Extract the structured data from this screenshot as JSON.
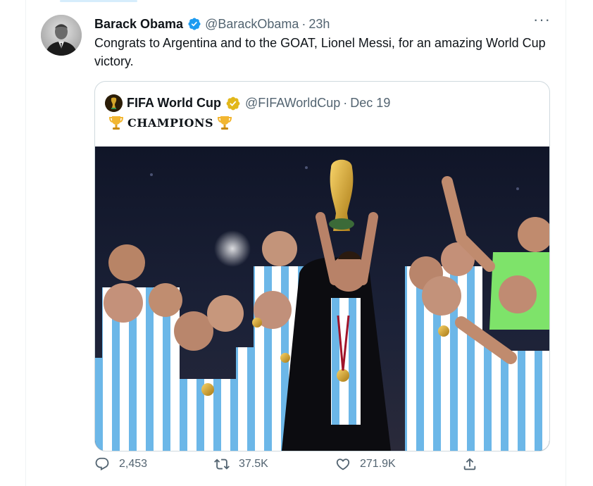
{
  "tweet": {
    "author_name": "Barack Obama",
    "handle": "@BarackObama",
    "separator": "·",
    "time": "23h",
    "more_label": "···",
    "text": "Congrats to Argentina and to the GOAT, Lionel Messi, for an amazing World Cup victory."
  },
  "quoted": {
    "author_name": "FIFA World Cup",
    "handle": "@FIFAWorldCup",
    "separator": "·",
    "date": "Dec 19",
    "text": "CHAMPIONS"
  },
  "actions": {
    "replies": "2,453",
    "retweets": "37.5K",
    "likes": "271.9K"
  },
  "colors": {
    "accent": "#1d9bf0",
    "verified_gold": "#e2b719",
    "muted_text": "#536471"
  },
  "icons": [
    "verified-badge-icon",
    "more-icon",
    "trophy-icon",
    "reply-icon",
    "retweet-icon",
    "like-icon",
    "share-icon"
  ]
}
